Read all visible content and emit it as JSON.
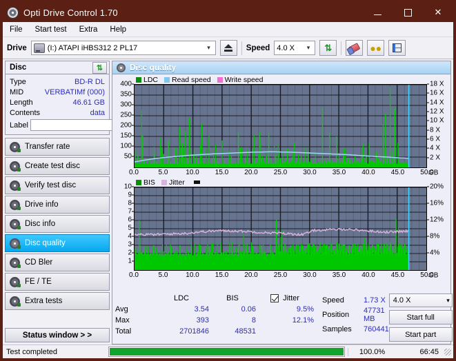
{
  "window": {
    "title": "Opti Drive Control 1.70",
    "app_icon": "disc-icon",
    "minimize": "—",
    "maximize": "□",
    "close": "✕"
  },
  "menu": {
    "items": [
      "File",
      "Start test",
      "Extra",
      "Help"
    ]
  },
  "toolbar": {
    "drive_label": "Drive",
    "drive_value": "(I:)  ATAPI iHBS312  2 PL17",
    "eject_icon": "eject-icon",
    "speed_label": "Speed",
    "speed_value": "4.0 X",
    "refresh_icon": "refresh-icon",
    "erase_icon": "eraser-icon",
    "coins_icon": "coins-icon",
    "save_icon": "floppy-disk-icon"
  },
  "disc_panel": {
    "title": "Disc",
    "refresh_icon": "refresh-icon",
    "rows": [
      {
        "key": "Type",
        "value": "BD-R DL"
      },
      {
        "key": "MID",
        "value": "VERBATIMf (000)"
      },
      {
        "key": "Length",
        "value": "46.61 GB"
      },
      {
        "key": "Contents",
        "value": "data"
      }
    ],
    "label_key": "Label",
    "label_value": "",
    "label_placeholder": "",
    "disc_icon": "disc-icon"
  },
  "nav": {
    "items": [
      {
        "label": "Transfer rate",
        "active": false
      },
      {
        "label": "Create test disc",
        "active": false
      },
      {
        "label": "Verify test disc",
        "active": false
      },
      {
        "label": "Drive info",
        "active": false
      },
      {
        "label": "Disc info",
        "active": false
      },
      {
        "label": "Disc quality",
        "active": true
      },
      {
        "label": "CD Bler",
        "active": false
      },
      {
        "label": "FE / TE",
        "active": false
      },
      {
        "label": "Extra tests",
        "active": false
      }
    ],
    "status_window": "Status window > >"
  },
  "main": {
    "header_title": "Disc quality",
    "header_icon": "disc-quality-icon"
  },
  "chart_data": [
    {
      "type": "line",
      "name": "top-chart",
      "title": "",
      "legend": [
        {
          "label": "LDC",
          "color": "#0b8a0b"
        },
        {
          "label": "Read speed",
          "color": "#7ec8f0"
        },
        {
          "label": "Write speed",
          "color": "#f070d0"
        }
      ],
      "legend_position": "top-left",
      "xlabel": "GB",
      "x_unit": "GB",
      "xlim": [
        0,
        50
      ],
      "xticks": [
        0.0,
        5.0,
        10.0,
        15.0,
        20.0,
        25.0,
        30.0,
        35.0,
        40.0,
        45.0,
        50.0
      ],
      "xticklabels": [
        "0.0",
        "5.0",
        "10.0",
        "15.0",
        "20.0",
        "25.0",
        "30.0",
        "35.0",
        "40.0",
        "45.0",
        "50.0"
      ],
      "ylabel": "",
      "ylim": [
        0,
        400
      ],
      "yticks": [
        50,
        100,
        150,
        200,
        250,
        300,
        350,
        400
      ],
      "yticklabels": [
        "50",
        "100",
        "150",
        "200",
        "250",
        "300",
        "350",
        "400"
      ],
      "y2label": "",
      "y2lim": [
        0,
        18
      ],
      "y2ticks": [
        2,
        4,
        6,
        8,
        10,
        12,
        14,
        16,
        18
      ],
      "y2ticklabels": [
        "2 X",
        "4 X",
        "6 X",
        "8 X",
        "10 X",
        "12 X",
        "14 X",
        "16 X",
        "18 X"
      ],
      "grid": true,
      "plot_bg": "#67748f",
      "series": [
        {
          "name": "LDC",
          "type": "bar",
          "color": "#00c000",
          "note": "dense green error spikes, baseline ~10-40, frequent spikes 80-400, denser after 25 GB",
          "x": [
            0.2,
            0.6,
            1.0,
            1.4,
            1.8,
            2.2,
            2.6,
            3.0,
            3.4,
            3.8,
            4.2,
            4.6,
            5.0,
            5.4,
            5.8,
            6.2,
            6.6,
            7.0,
            7.4,
            7.8,
            8.2,
            8.6,
            9.0,
            9.4,
            9.8,
            10.2,
            10.6,
            11.0,
            11.4,
            11.8,
            12.2,
            12.6,
            13.0,
            13.4,
            13.8,
            14.2,
            14.6,
            15.0,
            15.4,
            15.8,
            16.2,
            16.6,
            17.0,
            17.4,
            17.8,
            18.2,
            18.6,
            19.0,
            19.4,
            19.8,
            20.2,
            20.6,
            21.0,
            21.4,
            21.8,
            22.2,
            22.6,
            23.0,
            23.4,
            23.8,
            24.2,
            24.6,
            25.0,
            25.4,
            25.8,
            26.2,
            26.6,
            27.0,
            27.4,
            27.8,
            28.2,
            28.6,
            29.0,
            29.4,
            29.8,
            30.2,
            30.6,
            31.0,
            31.4,
            31.8,
            32.2,
            32.6,
            33.0,
            33.4,
            33.8,
            34.2,
            34.6,
            35.0,
            35.4,
            35.8,
            36.2,
            36.6,
            37.0,
            37.4,
            37.8,
            38.2,
            38.6,
            39.0,
            39.4,
            39.8,
            40.2,
            40.6,
            41.0,
            41.4,
            41.8,
            42.2,
            42.6,
            43.0,
            43.4,
            43.8,
            44.2,
            44.6,
            45.0,
            45.4,
            45.8,
            46.2,
            46.6,
            47.0
          ],
          "values": [
            25,
            60,
            20,
            155,
            30,
            18,
            45,
            22,
            70,
            30,
            14,
            22,
            65,
            18,
            130,
            28,
            16,
            95,
            30,
            12,
            120,
            24,
            48,
            35,
            18,
            85,
            40,
            20,
            30,
            26,
            18,
            38,
            22,
            14,
            45,
            28,
            20,
            130,
            34,
            18,
            36,
            52,
            20,
            28,
            170,
            30,
            22,
            44,
            30,
            26,
            90,
            38,
            24,
            170,
            48,
            30,
            55,
            165,
            40,
            22,
            60,
            35,
            45,
            25,
            30,
            90,
            20,
            50,
            120,
            30,
            25,
            55,
            28,
            18,
            75,
            36,
            20,
            45,
            22,
            30,
            290,
            40,
            28,
            170,
            35,
            25,
            150,
            40,
            30,
            60,
            26,
            45,
            35,
            22,
            55,
            30,
            20,
            40,
            25,
            60,
            120,
            35,
            25,
            80,
            45,
            30,
            210,
            260,
            50,
            390,
            80,
            285
          ]
        },
        {
          "name": "Read speed",
          "type": "line",
          "color": "#9fd8f5",
          "note": "smooth curve rising then falling, in X units on right axis",
          "x": [
            0,
            2,
            4,
            6,
            8,
            10,
            12,
            14,
            16,
            18,
            20,
            22,
            24,
            25,
            26,
            28,
            30,
            32,
            34,
            36,
            38,
            40,
            42,
            44,
            45,
            46,
            47
          ],
          "values_x": [
            1.2,
            1.6,
            1.95,
            2.2,
            2.4,
            2.6,
            2.75,
            2.9,
            3.0,
            3.1,
            3.2,
            3.3,
            3.35,
            3.4,
            3.35,
            3.3,
            3.2,
            3.1,
            3.0,
            2.9,
            2.8,
            2.65,
            2.5,
            2.35,
            2.25,
            2.1,
            2.0
          ]
        },
        {
          "name": "Write speed",
          "type": "line",
          "color": "#f070d0",
          "values": []
        }
      ],
      "markers": [
        {
          "label": "end-of-data",
          "x": 47.0,
          "color": "#3fd0ff"
        }
      ]
    },
    {
      "type": "line",
      "name": "bottom-chart",
      "title": "",
      "legend": [
        {
          "label": "BIS",
          "color": "#0b8a0b"
        },
        {
          "label": "Jitter",
          "color": "#d9b3dd"
        }
      ],
      "legend_position": "top-left",
      "xlabel": "GB",
      "x_unit": "GB",
      "xlim": [
        0,
        50
      ],
      "xticks": [
        0.0,
        5.0,
        10.0,
        15.0,
        20.0,
        25.0,
        30.0,
        35.0,
        40.0,
        45.0,
        50.0
      ],
      "xticklabels": [
        "0.0",
        "5.0",
        "10.0",
        "15.0",
        "20.0",
        "25.0",
        "30.0",
        "35.0",
        "40.0",
        "45.0",
        "50.0"
      ],
      "ylim": [
        0,
        10
      ],
      "yticks": [
        1,
        2,
        3,
        4,
        5,
        6,
        7,
        8,
        9,
        10
      ],
      "yticklabels": [
        "1",
        "2",
        "3",
        "4",
        "5",
        "6",
        "7",
        "8",
        "9",
        "10"
      ],
      "y2lim": [
        0,
        20
      ],
      "y2ticks": [
        4,
        8,
        12,
        16,
        20
      ],
      "y2ticklabels": [
        "4%",
        "8%",
        "12%",
        "16%",
        "20%"
      ],
      "grid": true,
      "plot_bg": "#67748f",
      "series": [
        {
          "name": "BIS",
          "type": "bar",
          "color": "#00c000",
          "note": "dense green band baseline ~1.8-2.2 with spikes to 3-6 and occasional 7-8",
          "x": [
            0.3,
            0.8,
            1.3,
            1.8,
            2.3,
            2.8,
            3.3,
            3.8,
            4.3,
            4.8,
            5.3,
            5.8,
            6.3,
            6.8,
            7.3,
            7.8,
            8.3,
            8.8,
            9.3,
            9.8,
            10.3,
            10.8,
            11.3,
            11.8,
            12.3,
            12.8,
            13.3,
            13.8,
            14.3,
            14.8,
            15.3,
            15.8,
            16.3,
            16.8,
            17.3,
            17.8,
            18.3,
            18.8,
            19.3,
            19.8,
            20.3,
            20.8,
            21.3,
            21.8,
            22.3,
            22.8,
            23.3,
            23.8,
            24.3,
            24.8,
            25.3,
            25.8,
            26.3,
            26.8,
            27.3,
            27.8,
            28.3,
            28.8,
            29.3,
            29.8,
            30.3,
            30.8,
            31.3,
            31.8,
            32.3,
            32.8,
            33.3,
            33.8,
            34.3,
            34.8,
            35.3,
            35.8,
            36.3,
            36.8,
            37.3,
            37.8,
            38.3,
            38.8,
            39.3,
            39.8,
            40.3,
            40.8,
            41.3,
            41.8,
            42.3,
            42.8,
            43.3,
            43.8,
            44.3,
            44.8,
            45.3,
            45.8,
            46.3,
            46.8
          ],
          "values": [
            2.0,
            6.0,
            2.1,
            2.0,
            2.2,
            2.0,
            3.0,
            2.1,
            2.0,
            3.1,
            2.0,
            2.2,
            2.9,
            2.0,
            2.1,
            3.0,
            2.0,
            2.2,
            2.0,
            2.9,
            2.1,
            2.0,
            3.0,
            2.0,
            2.1,
            2.9,
            2.0,
            2.2,
            2.0,
            3.0,
            2.1,
            2.0,
            2.9,
            2.2,
            2.0,
            3.0,
            2.0,
            2.1,
            3.2,
            2.0,
            2.9,
            2.1,
            2.0,
            3.0,
            2.2,
            2.0,
            3.1,
            2.0,
            6.1,
            3.0,
            2.2,
            3.2,
            2.0,
            3.0,
            2.4,
            3.1,
            2.2,
            3.0,
            2.6,
            3.2,
            2.2,
            3.0,
            2.4,
            3.4,
            2.2,
            3.0,
            2.6,
            3.2,
            2.2,
            3.0,
            2.4,
            3.1,
            2.2,
            3.0,
            2.6,
            3.2,
            2.4,
            3.0,
            2.2,
            3.4,
            2.6,
            3.0,
            2.4,
            3.2,
            2.2,
            3.0,
            2.6,
            3.4,
            2.4,
            6.2,
            3.0,
            2.6,
            3.2,
            2.4
          ]
        },
        {
          "name": "Jitter",
          "type": "line",
          "color": "#d9b3dd",
          "note": "noisy pink band ~8.6% rising to ~10% mid-disc, dipping then rising near end, on right % axis",
          "x": [
            0,
            2,
            4,
            6,
            8,
            10,
            12,
            14,
            16,
            18,
            20,
            22,
            24,
            25,
            26,
            28,
            30,
            32,
            34,
            36,
            38,
            40,
            42,
            44,
            45,
            46,
            47
          ],
          "values_pct": [
            8.7,
            8.6,
            8.6,
            8.7,
            8.8,
            8.9,
            9.2,
            9.4,
            9.5,
            9.5,
            9.4,
            9.3,
            9.1,
            9.0,
            8.9,
            8.7,
            8.6,
            9.6,
            9.7,
            9.8,
            9.9,
            9.7,
            9.5,
            9.3,
            9.2,
            9.3,
            9.4
          ]
        }
      ],
      "markers": [
        {
          "label": "end-of-data",
          "x": 47.0,
          "color": "#3fd0ff"
        }
      ]
    }
  ],
  "stats": {
    "col_headers": [
      "LDC",
      "BIS"
    ],
    "jitter_label": "Jitter",
    "jitter_checked": true,
    "rows": [
      {
        "label": "Avg",
        "ldc": "3.54",
        "bis": "0.06",
        "jitter": "9.5%"
      },
      {
        "label": "Max",
        "ldc": "393",
        "bis": "8",
        "jitter": "12.1%"
      },
      {
        "label": "Total",
        "ldc": "2701846",
        "bis": "48531",
        "jitter": ""
      }
    ]
  },
  "test_panel": {
    "speed_label": "Speed",
    "speed_value": "1.73 X",
    "position_label": "Position",
    "position_value": "47731 MB",
    "samples_label": "Samples",
    "samples_value": "760441",
    "speed_select": "4.0 X",
    "start_full": "Start full",
    "start_part": "Start part"
  },
  "statusbar": {
    "message": "Test completed",
    "progress_percent": 100,
    "percent_text": "100.0%",
    "elapsed": "66:45"
  }
}
